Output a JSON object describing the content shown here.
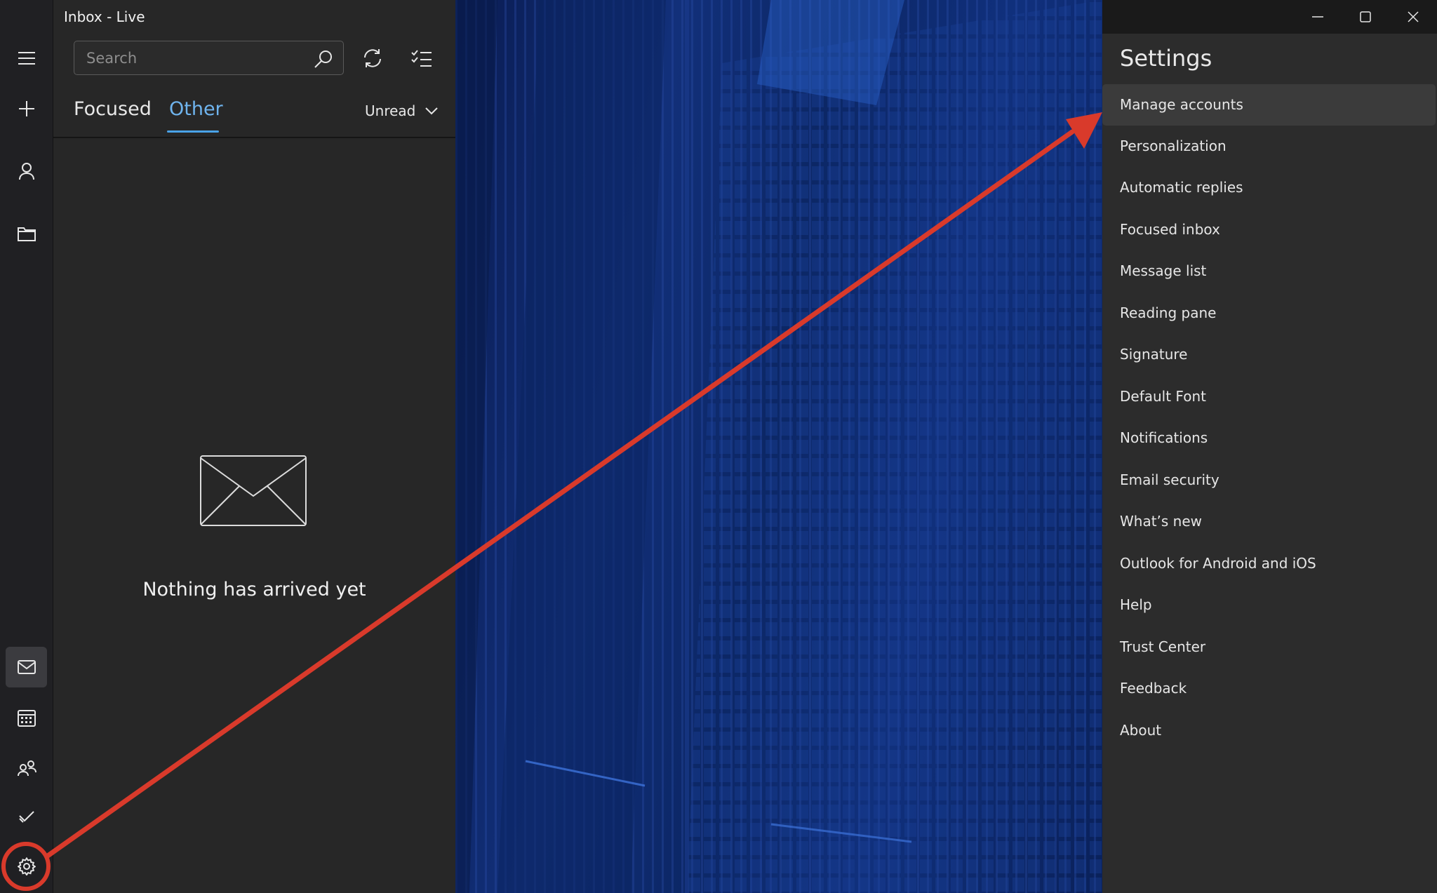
{
  "window": {
    "title": "Inbox - Live"
  },
  "rail": {
    "items": [
      {
        "name": "menu-icon"
      },
      {
        "name": "new-mail-icon"
      },
      {
        "name": "accounts-icon"
      },
      {
        "name": "folders-icon"
      },
      {
        "name": "mail-icon",
        "active": true
      },
      {
        "name": "calendar-icon"
      },
      {
        "name": "people-icon"
      },
      {
        "name": "todo-icon"
      },
      {
        "name": "settings-icon"
      }
    ]
  },
  "list": {
    "search_placeholder": "Search",
    "tabs": [
      {
        "label": "Focused",
        "selected": false
      },
      {
        "label": "Other",
        "selected": true
      }
    ],
    "filter_label": "Unread",
    "empty_message": "Nothing has arrived yet"
  },
  "settings": {
    "title": "Settings",
    "items": [
      {
        "label": "Manage accounts"
      },
      {
        "label": "Personalization"
      },
      {
        "label": "Automatic replies"
      },
      {
        "label": "Focused inbox"
      },
      {
        "label": "Message list"
      },
      {
        "label": "Reading pane"
      },
      {
        "label": "Signature"
      },
      {
        "label": "Default Font"
      },
      {
        "label": "Notifications"
      },
      {
        "label": "Email security"
      },
      {
        "label": "What’s new"
      },
      {
        "label": "Outlook for Android and iOS"
      },
      {
        "label": "Help"
      },
      {
        "label": "Trust Center"
      },
      {
        "label": "Feedback"
      },
      {
        "label": "About"
      }
    ]
  },
  "colors": {
    "accent": "#4aa3e8",
    "annotation": "#d93a2b"
  }
}
